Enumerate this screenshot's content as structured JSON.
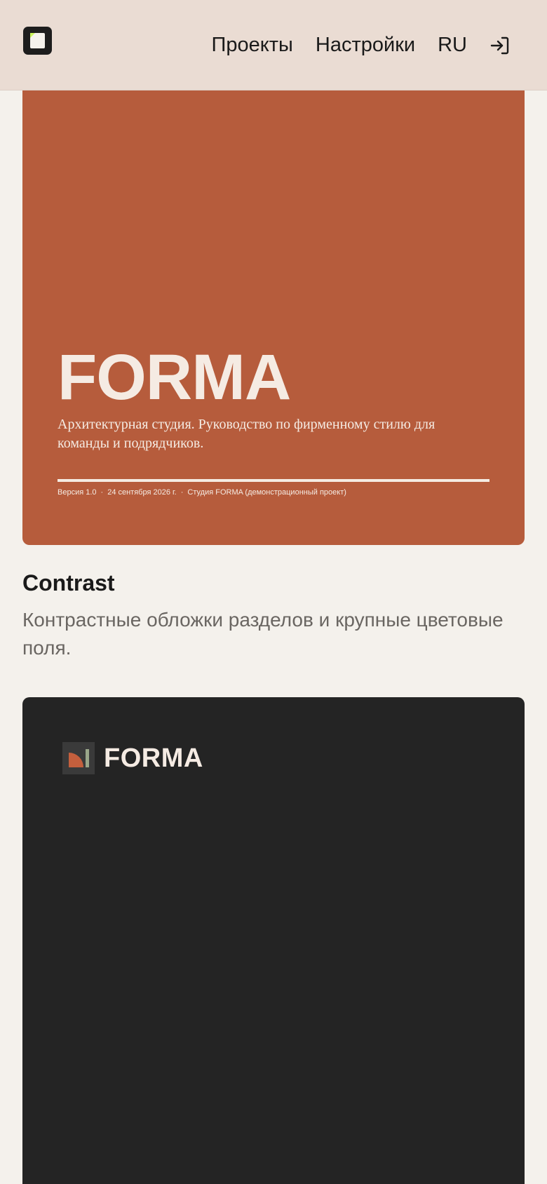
{
  "header": {
    "nav": {
      "projects": "Проекты",
      "settings": "Настройки",
      "language": "RU"
    },
    "icons": {
      "logo": "document-icon",
      "login": "login-arrow-icon"
    }
  },
  "hero": {
    "title": "FORMA",
    "subtitle": "Архитектурная студия. Руководство по фирменному стилю для команды и подрядчиков.",
    "meta": {
      "version": "Версия 1.0",
      "date": "24 сентября 2026 г.",
      "studio": "Студия FORMA (демонстрационный проект)",
      "separator": "·"
    },
    "background_color": "#b65c3c"
  },
  "section": {
    "title": "Contrast",
    "description": "Контрастные обложки разделов и крупные цветовые поля."
  },
  "dark_card": {
    "brand_word": "FORMA",
    "background_color": "#242424"
  }
}
